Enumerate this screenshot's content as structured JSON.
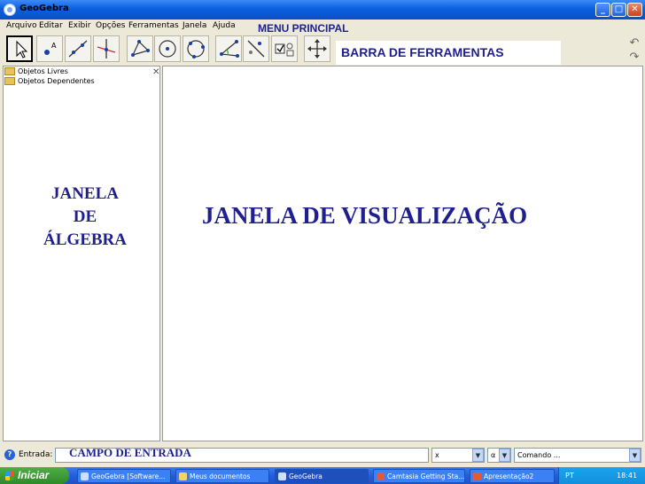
{
  "window": {
    "title": "GeoGebra",
    "minimize": "_",
    "maximize": "□",
    "close": "✕"
  },
  "menu": {
    "items": [
      "Arquivo",
      "Editar",
      "Exibir",
      "Opções",
      "Ferramentas",
      "Janela",
      "Ajuda"
    ],
    "annotation": "MENU PRINCIPAL"
  },
  "toolbar": {
    "tools": [
      "move-tool",
      "point-tool",
      "line-tool",
      "perpendicular-line-tool",
      "polygon-tool",
      "circle-center-point-tool",
      "circle-three-points-tool",
      "angle-tool",
      "reflect-tool",
      "checkbox-tool",
      "move-graphics-view-tool"
    ],
    "annotation": "BARRA DE FERRAMENTAS",
    "undo": "↶",
    "redo": "↷"
  },
  "algebra": {
    "tree": [
      "Objetos Livres",
      "Objetos Dependentes"
    ],
    "close": "✕",
    "annotation": "JANELA\nDE\nÁLGEBRA"
  },
  "graphics": {
    "annotation": "JANELA DE VISUALIZAÇÃO"
  },
  "input": {
    "help": "?",
    "label": "Entrada:",
    "annotation": "CAMPO DE ENTRADA",
    "select1": "x",
    "select2": "α",
    "select3": "Comando ...",
    "dropdown": "▼"
  },
  "taskbar": {
    "start": "Iniciar",
    "tasks": [
      "GeoGebra [Software...",
      "Meus documentos",
      "GeoGebra",
      "Camtasia Getting Sta...",
      "Apresentação2"
    ],
    "lang": "PT",
    "time": "18:41"
  },
  "colors": {
    "annotation": "#1f1f8f",
    "titlebar": "#0a5fe0",
    "taskbar": "#245edc"
  }
}
